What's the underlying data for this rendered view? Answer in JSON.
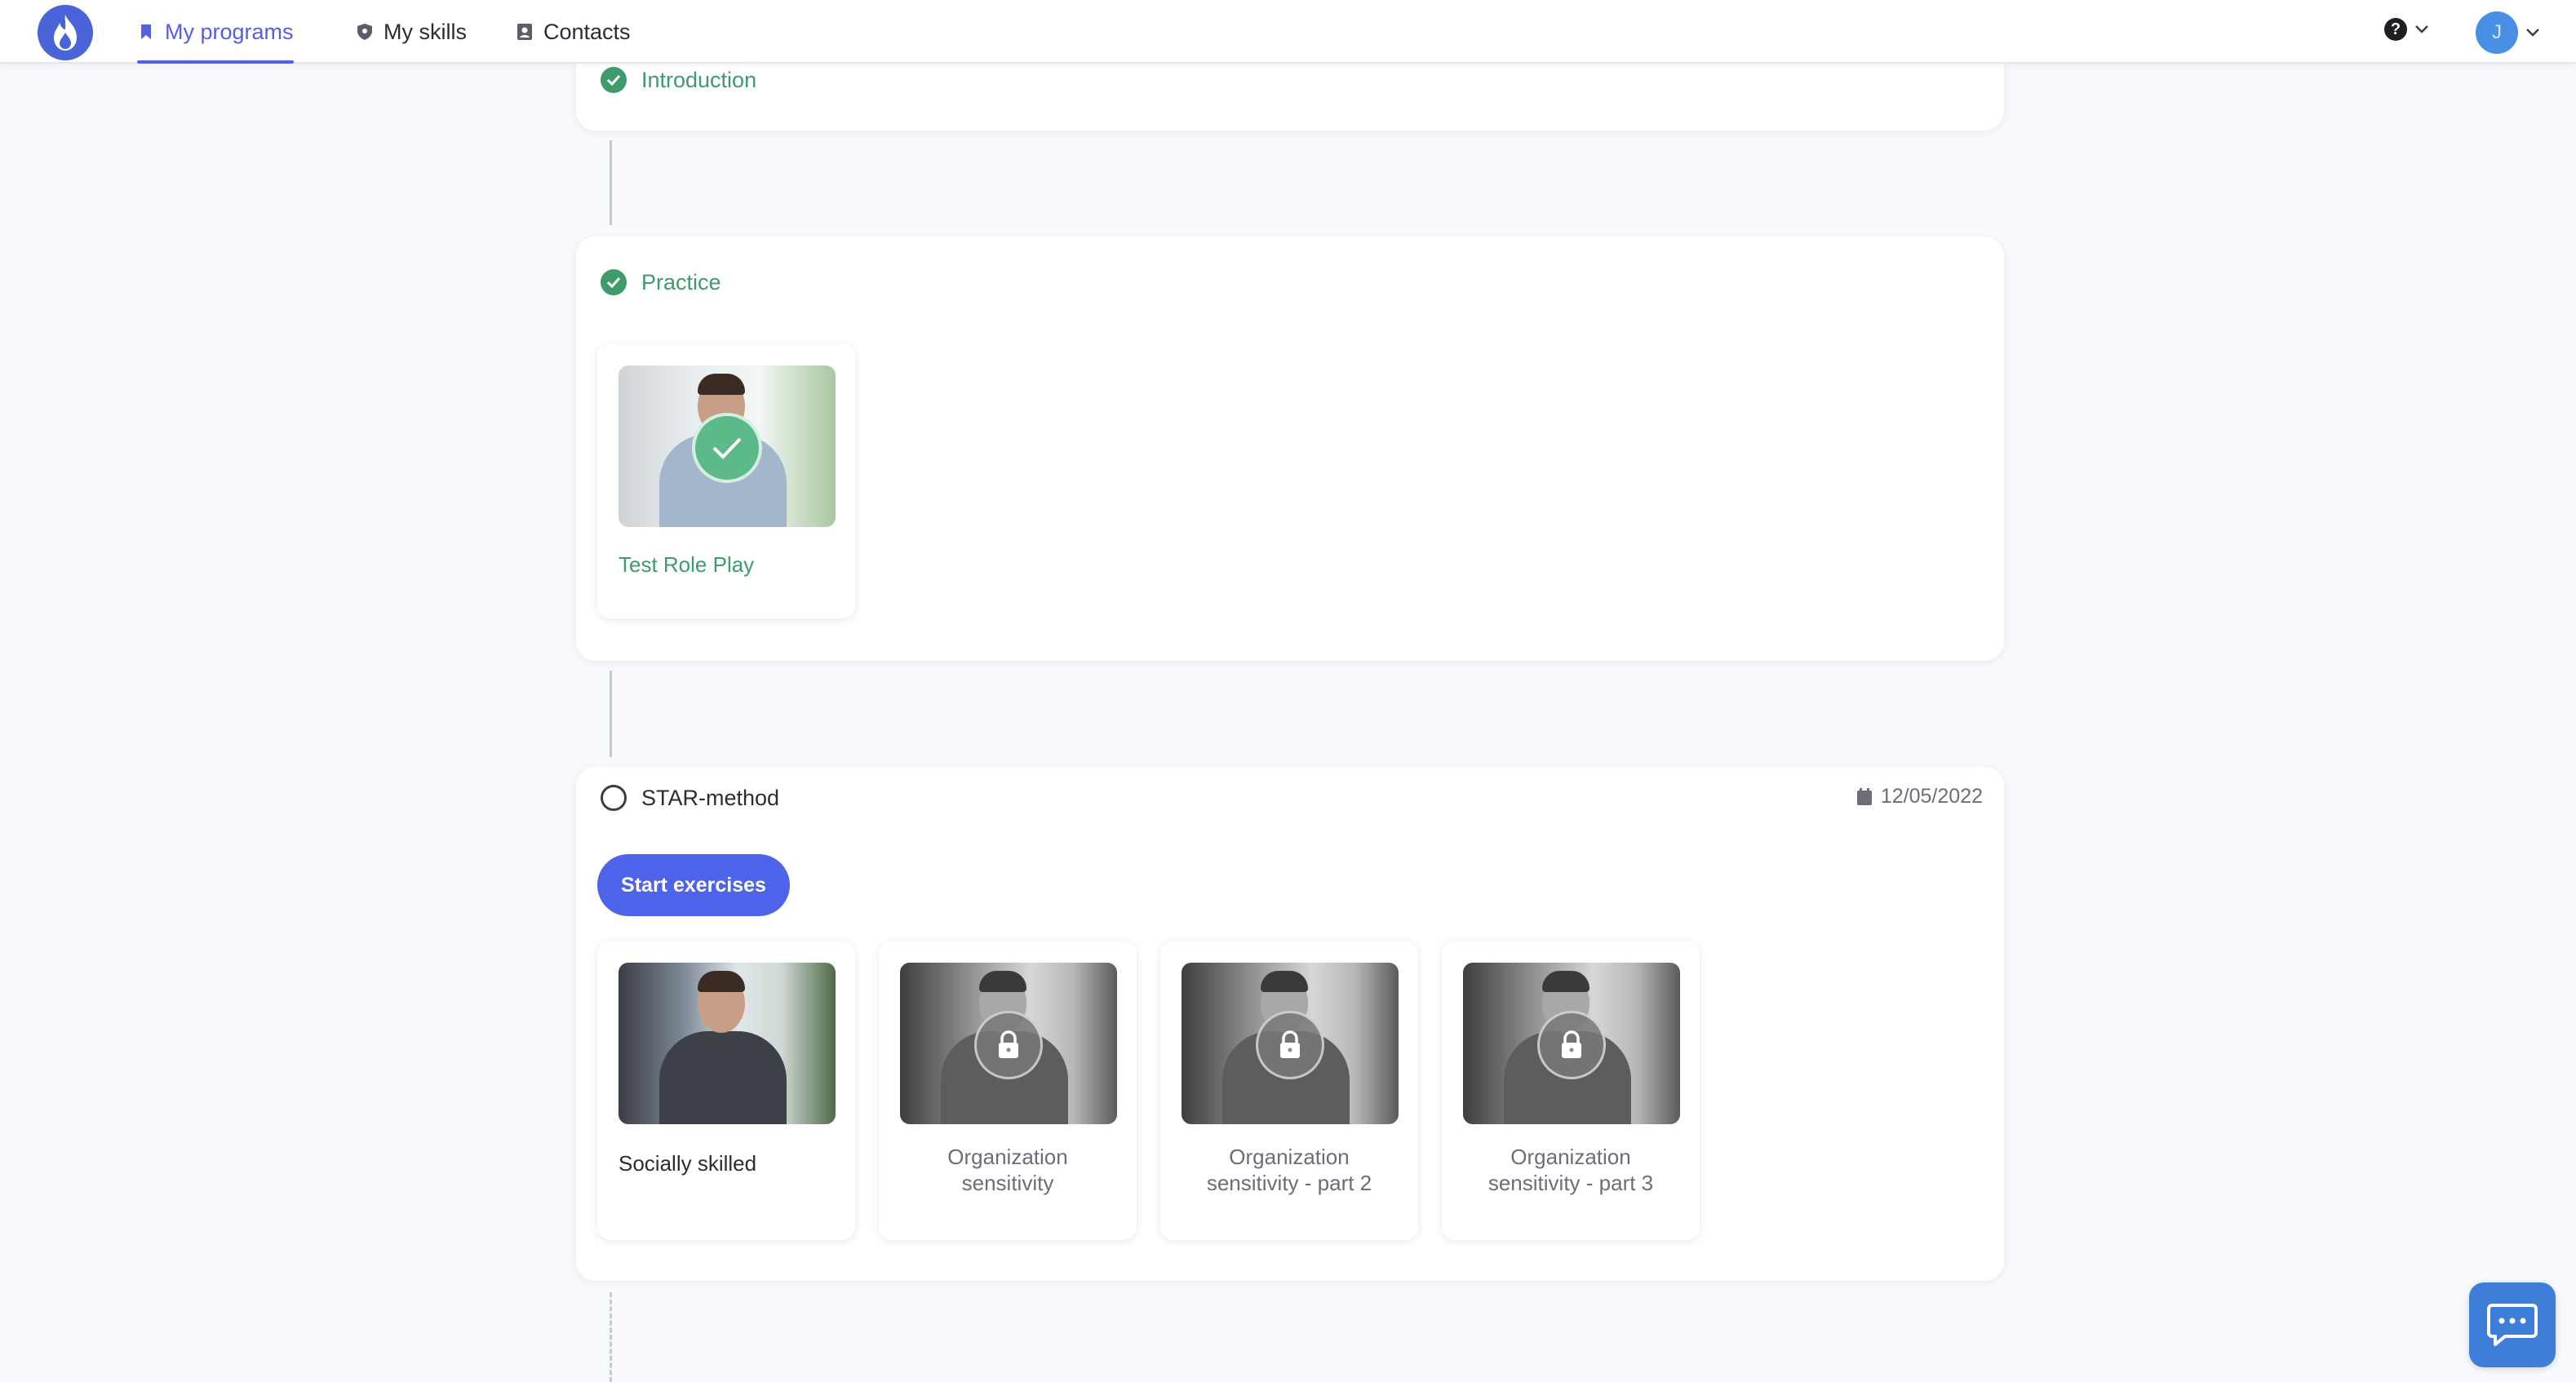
{
  "nav": {
    "items": [
      {
        "label": "My programs",
        "icon": "bookmark-icon",
        "active": true
      },
      {
        "label": "My skills",
        "icon": "shield-icon",
        "active": false
      },
      {
        "label": "Contacts",
        "icon": "contacts-icon",
        "active": false
      }
    ],
    "help_icon": "?",
    "avatar_initial": "J"
  },
  "sections": {
    "introduction": {
      "title": "Introduction",
      "status": "completed"
    },
    "practice": {
      "title": "Practice",
      "status": "completed",
      "cards": [
        {
          "label": "Test Role Play",
          "status": "completed"
        }
      ]
    },
    "star": {
      "title": "STAR-method",
      "status": "open",
      "date": "12/05/2022",
      "start_button": "Start exercises",
      "cards": [
        {
          "label": "Socially skilled",
          "status": "available"
        },
        {
          "label": "Organization sensitivity",
          "status": "locked"
        },
        {
          "label": "Organization sensitivity - part 2",
          "status": "locked"
        },
        {
          "label": "Organization sensitivity - part 3",
          "status": "locked"
        }
      ]
    }
  },
  "colors": {
    "accent": "#5360e0",
    "success": "#3f9a6c",
    "button": "#4d63ea",
    "background": "#f7f9fc"
  }
}
